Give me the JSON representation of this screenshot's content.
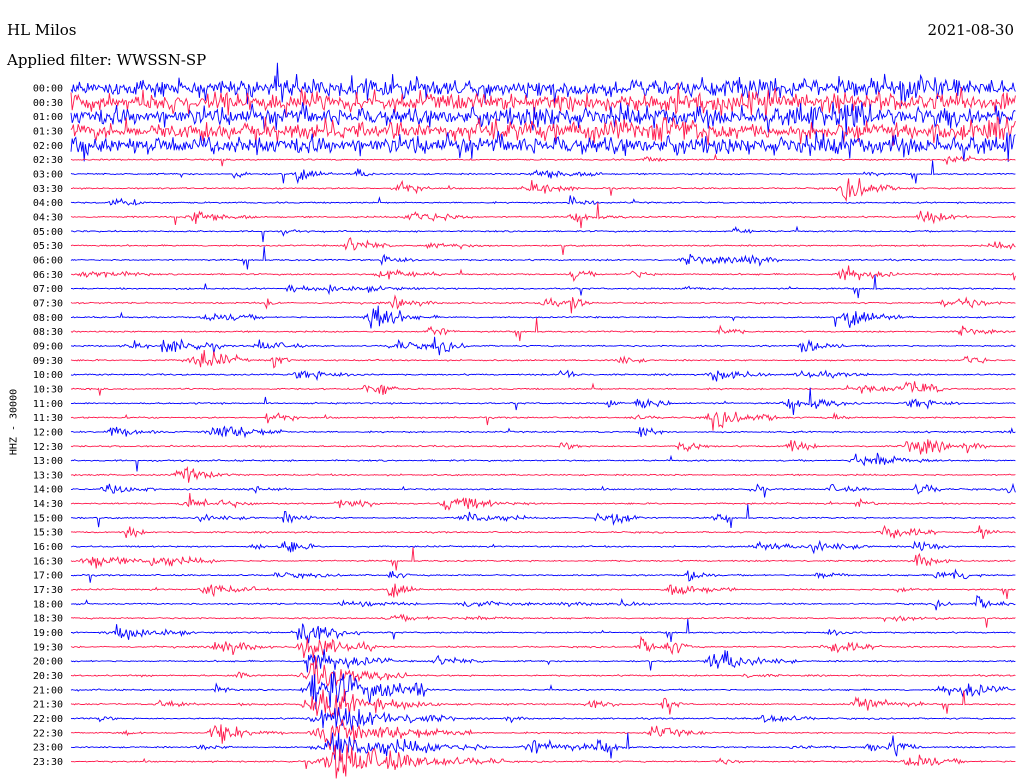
{
  "header": {
    "station": "HL Milos",
    "date": "2021-08-30",
    "filter": "Applied filter: WWSSN-SP"
  },
  "chart_data": {
    "type": "line",
    "title": "HL Milos",
    "date": "2021-08-30",
    "ylabel": "HHZ - 30000",
    "tick_labels": [
      "00:00",
      "00:30",
      "01:00",
      "01:30",
      "02:00",
      "02:30",
      "03:00",
      "03:30",
      "04:00",
      "04:30",
      "05:00",
      "05:30",
      "06:00",
      "06:30",
      "07:00",
      "07:30",
      "08:00",
      "08:30",
      "09:00",
      "09:30",
      "10:00",
      "10:30",
      "11:00",
      "11:30",
      "12:00",
      "12:30",
      "13:00",
      "13:30",
      "14:00",
      "14:30",
      "15:00",
      "15:30",
      "16:00",
      "16:30",
      "17:00",
      "17:30",
      "18:00",
      "18:30",
      "19:00",
      "19:30",
      "20:00",
      "20:30",
      "21:00",
      "21:30",
      "22:00",
      "22:30",
      "23:00",
      "23:30"
    ],
    "trace_colors": [
      "#0000ff",
      "#ff1a4d"
    ],
    "grid": false
  }
}
